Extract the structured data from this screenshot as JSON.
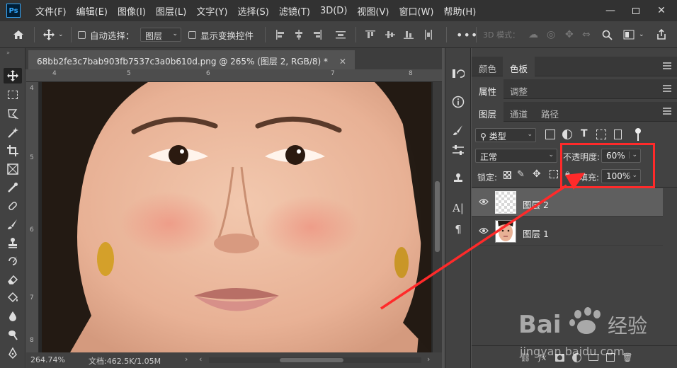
{
  "menubar": {
    "logo": "Ps",
    "items": [
      "文件(F)",
      "编辑(E)",
      "图像(I)",
      "图层(L)",
      "文字(Y)",
      "选择(S)",
      "滤镜(T)",
      "3D(D)",
      "视图(V)",
      "窗口(W)",
      "帮助(H)"
    ],
    "controls": [
      "minimize-icon",
      "restore-icon",
      "close-icon"
    ]
  },
  "options_bar": {
    "auto_select_label": "自动选择：",
    "auto_select_value": "图层",
    "show_transform_label": "显示变换控件",
    "mode_3d_label": "3D 模式："
  },
  "document": {
    "tab_title": "68bb2fe3c7bab903fb7537c3a0b610d.png @ 265% (图层 2, RGB/8) *",
    "ruler_top": [
      "4",
      "5",
      "6",
      "7",
      "8"
    ],
    "ruler_left": [
      "4",
      "5",
      "6",
      "7",
      "8"
    ],
    "zoom": "264.74%",
    "doc_info": "文档:462.5K/1.05M"
  },
  "panels": {
    "group1": {
      "tabs": [
        "颜色",
        "色板"
      ],
      "active": 1
    },
    "group2": {
      "tabs": [
        "属性",
        "调整"
      ],
      "active": 0
    },
    "layers": {
      "tabs": [
        "图层",
        "通道",
        "路径"
      ],
      "active": 0,
      "filter_label": "类型",
      "blend_mode": "正常",
      "opacity_label": "不透明度:",
      "opacity_value": "60%",
      "lock_label": "锁定:",
      "fill_label": "填充:",
      "fill_value": "100%",
      "items": [
        {
          "name": "图层 2",
          "selected": true,
          "type": "transparent"
        },
        {
          "name": "图层 1",
          "selected": false,
          "type": "photo"
        }
      ]
    }
  },
  "annotation": {
    "color": "#ff2a2a"
  },
  "watermark": {
    "brand": "Bai",
    "brand_cn": "经验",
    "url": "jingyan.baidu.com"
  }
}
